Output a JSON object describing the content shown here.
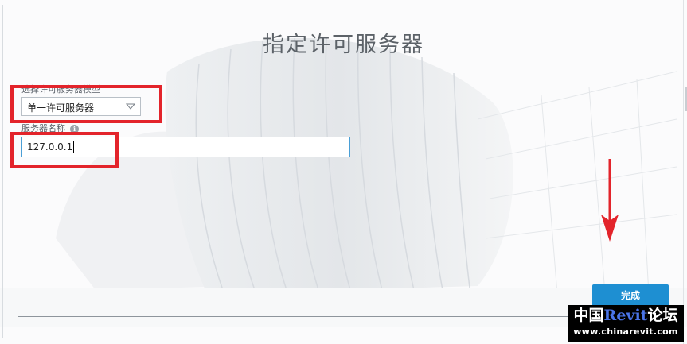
{
  "dialog": {
    "title": "指定许可服务器"
  },
  "license_type": {
    "label": "选择许可服务器模型",
    "selected": "单一许可服务器"
  },
  "server_name": {
    "label": "服务器名称",
    "info_icon": "info-icon",
    "value": "127.0.0.1"
  },
  "actions": {
    "finish_label": "完成"
  },
  "watermark": {
    "line1_prefix": "中国",
    "line1_accent": "Revit",
    "line1_suffix": "论坛",
    "line2": "www.chinarevit.com"
  },
  "colors": {
    "annotation_red": "#e3242b",
    "finish_button_bg": "#1e8fd2",
    "input_focus_border": "#4a9fd6",
    "watermark_accent": "#4a74e8"
  }
}
